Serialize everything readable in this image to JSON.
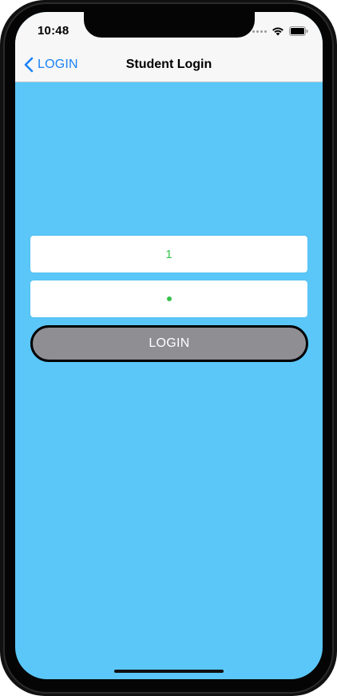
{
  "status_bar": {
    "time": "10:48",
    "icons": [
      "signal-dots-icon",
      "wifi-icon",
      "battery-icon"
    ]
  },
  "nav": {
    "back_label": "LOGIN",
    "back_icon": "chevron-left-icon",
    "title": "Student Login"
  },
  "form": {
    "username_value": "1",
    "password_masked": "•",
    "login_label": "LOGIN"
  },
  "colors": {
    "background": "#5ac7f8",
    "accent": "#1a82f6",
    "field_text": "#35c24a",
    "button_fill": "#8e8e93",
    "button_border": "#000000"
  }
}
